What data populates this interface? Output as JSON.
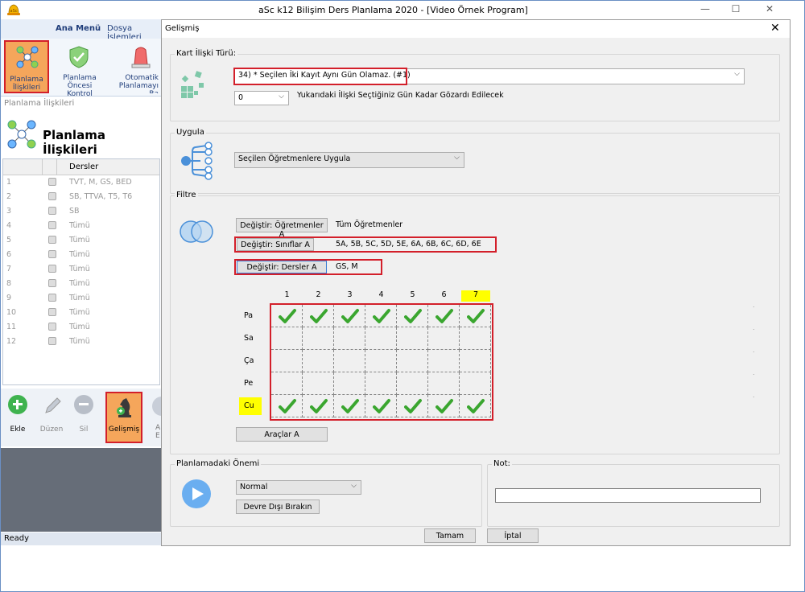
{
  "window": {
    "title": "aSc k12 Bilişim Ders Planlama 2020  - [Video Örnek Program]",
    "logo_text": "aSc"
  },
  "ribbon": {
    "tabs": [
      "Ana Menü",
      "Dosya İşlemleri"
    ],
    "buttons": [
      {
        "label1": "Planlama",
        "label2": "İlişkileri"
      },
      {
        "label1": "Planlama",
        "label2": "Öncesi Kontrol"
      },
      {
        "label1": "Otomatik",
        "label2": "Planlamayı Ba"
      }
    ]
  },
  "breadcrumb": "Planlama İlişkileri",
  "panel_title": "Planlama İlişkileri",
  "left_table": {
    "header": "Dersler",
    "rows": [
      {
        "num": "1",
        "text": "TVT, M, GS, BED"
      },
      {
        "num": "2",
        "text": "SB, TTVA, T5, T6"
      },
      {
        "num": "3",
        "text": "SB"
      },
      {
        "num": "4",
        "text": "Tümü"
      },
      {
        "num": "5",
        "text": "Tümü"
      },
      {
        "num": "6",
        "text": "Tümü"
      },
      {
        "num": "7",
        "text": "Tümü"
      },
      {
        "num": "8",
        "text": "Tümü"
      },
      {
        "num": "9",
        "text": "Tümü"
      },
      {
        "num": "10",
        "text": "Tümü"
      },
      {
        "num": "11",
        "text": "Tümü"
      },
      {
        "num": "12",
        "text": "Tümü"
      }
    ]
  },
  "left_toolbar": {
    "ekle": "Ekle",
    "duzen": "Düzen",
    "sil": "Sil",
    "gelismis": "Gelişmiş",
    "partial": "A",
    "partial2": "E"
  },
  "status": "Ready",
  "dialog": {
    "title": "Gelişmiş",
    "kart_label": "Kart İlişki Türü:",
    "kart_value": "34) * Seçilen İki Kayıt Aynı Gün Olamaz. (#1)",
    "ignore_value": "0",
    "ignore_text": "Yukarıdaki İlişki Seçtiğiniz Gün Kadar Gözardı Edilecek",
    "uygula_label": "Uygula",
    "uygula_value": "Seçilen Öğretmenlere Uygula",
    "filtre_label": "Filtre",
    "btn_teachers": "Değiştir: Öğretmenler A",
    "teachers_value": "Tüm Öğretmenler",
    "btn_classes": "Değiştir: Sınıflar A",
    "classes_value": "5A, 5B, 5C, 5D, 5E, 6A, 6B, 6C, 6D, 6E",
    "btn_lessons": "Değiştir: Dersler A",
    "lessons_value": "GS, M",
    "grid": {
      "columns": [
        "1",
        "2",
        "3",
        "4",
        "5",
        "6",
        "7"
      ],
      "highlight_col": "7",
      "rows": [
        {
          "day": "Pa",
          "checks": [
            true,
            true,
            true,
            true,
            true,
            true,
            true
          ]
        },
        {
          "day": "Sa",
          "checks": [
            false,
            false,
            false,
            false,
            false,
            false,
            false
          ]
        },
        {
          "day": "Ça",
          "checks": [
            false,
            false,
            false,
            false,
            false,
            false,
            false
          ]
        },
        {
          "day": "Pe",
          "checks": [
            false,
            false,
            false,
            false,
            false,
            false,
            false
          ]
        },
        {
          "day": "Cu",
          "checks": [
            true,
            true,
            true,
            true,
            true,
            true,
            true
          ],
          "highlight": true
        }
      ]
    },
    "araclar": "Araçlar A",
    "onem_label": "Planlamadaki Önemi",
    "onem_value": "Normal",
    "devre_disi": "Devre Dışı Bırakın",
    "not_label": "Not:",
    "not_value": "",
    "ok": "Tamam",
    "cancel": "İptal"
  },
  "colors": {
    "highlight_red": "#d31f2a",
    "check_green": "#3aa62f",
    "yellow": "#ffff00",
    "ribbon_hl": "#f5a65b"
  }
}
